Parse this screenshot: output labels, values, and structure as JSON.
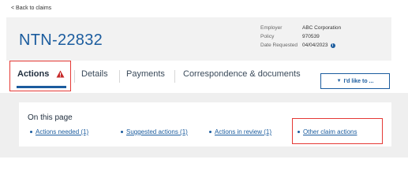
{
  "back_link": "< Back to claims",
  "claim": {
    "id": "NTN-22832",
    "meta": [
      {
        "label": "Employer",
        "value": "ABC Corporation"
      },
      {
        "label": "Policy",
        "value": "970539"
      },
      {
        "label": "Date Requested",
        "value": "04/04/2023"
      }
    ]
  },
  "tabs": {
    "actions": "Actions",
    "details": "Details",
    "payments": "Payments",
    "correspondence": "Correspondence & documents"
  },
  "like_button": "I'd like to ...",
  "on_this_page": {
    "title": "On this page",
    "links": [
      "Actions needed (1)",
      "Suggested actions (1)",
      "Actions in review (1)",
      "Other claim actions"
    ]
  },
  "colors": {
    "brand_blue": "#1b5c9e",
    "highlight_red": "#e53935",
    "warning_red": "#c62828"
  },
  "icons": {
    "warning": "warning-triangle-icon",
    "info": "info-icon",
    "dropdown": "chevron-down-icon"
  }
}
